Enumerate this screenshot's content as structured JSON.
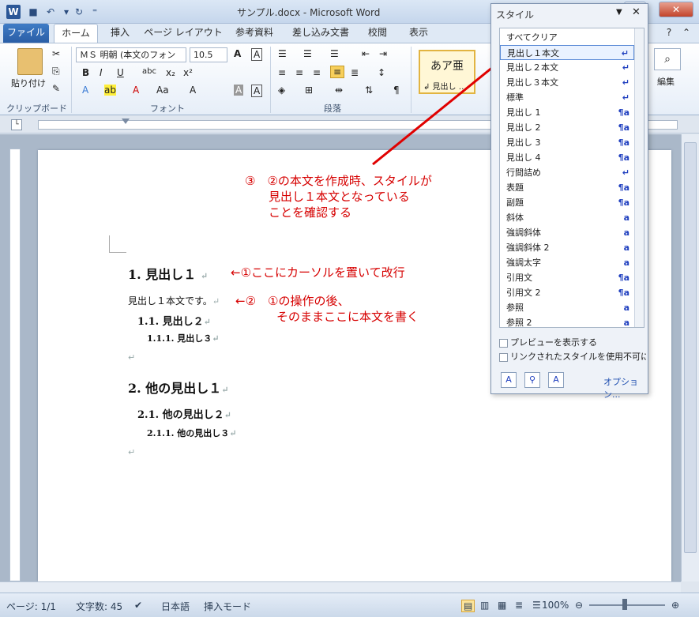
{
  "window": {
    "title": "サンプル.docx - Microsoft Word"
  },
  "tabs": [
    {
      "label": "ファイル"
    },
    {
      "label": "ホーム"
    },
    {
      "label": "挿入"
    },
    {
      "label": "ページ レイアウト"
    },
    {
      "label": "参考資料"
    },
    {
      "label": "差し込み文書"
    },
    {
      "label": "校閲"
    },
    {
      "label": "表示"
    }
  ],
  "ribbon": {
    "paste_label": "貼り付け",
    "font_name": "ＭＳ 明朝 (本文のフォン",
    "font_size": "10.5",
    "style_preview_text": "あア亜",
    "style_preview_name": "↲ 見出し …",
    "edit_label": "編集",
    "groups": {
      "clipboard": "クリップボード",
      "font": "フォント",
      "paragraph": "段落"
    }
  },
  "document": {
    "h1_first": "1. 見出し１",
    "body_first": "見出し１本文です。",
    "h2_first": "1.1. 見出し２",
    "h3_first": "1.1.1. 見出し３",
    "h1_second": "2. 他の見出し１",
    "h2_second": "2.1. 他の見出し２",
    "h3_second": "2.1.1. 他の見出し３",
    "para_mark": "↵"
  },
  "annotations": {
    "note1": "←①ここにカーソルを置いて改行",
    "note2_line1": "←②　①の操作の後、",
    "note2_line2": "そのままここに本文を書く",
    "note3_line1": "③　②の本文を作成時、スタイルが",
    "note3_line2": "見出し１本文となっている",
    "note3_line3": "ことを確認する"
  },
  "style_pane": {
    "title": "スタイル",
    "items": [
      {
        "name": "すべてクリア",
        "sym": ""
      },
      {
        "name": "見出し１本文",
        "sym": "↵"
      },
      {
        "name": "見出し２本文",
        "sym": "↵"
      },
      {
        "name": "見出し３本文",
        "sym": "↵"
      },
      {
        "name": "標準",
        "sym": "↵"
      },
      {
        "name": "見出し 1",
        "sym": "¶a"
      },
      {
        "name": "見出し 2",
        "sym": "¶a"
      },
      {
        "name": "見出し 3",
        "sym": "¶a"
      },
      {
        "name": "見出し 4",
        "sym": "¶a"
      },
      {
        "name": "行間詰め",
        "sym": "↵"
      },
      {
        "name": "表題",
        "sym": "¶a"
      },
      {
        "name": "副題",
        "sym": "¶a"
      },
      {
        "name": "斜体",
        "sym": "a"
      },
      {
        "name": "強調斜体",
        "sym": "a"
      },
      {
        "name": "強調斜体 2",
        "sym": "a"
      },
      {
        "name": "強調太字",
        "sym": "a"
      },
      {
        "name": "引用文",
        "sym": "¶a"
      },
      {
        "name": "引用文 2",
        "sym": "¶a"
      },
      {
        "name": "参照",
        "sym": "a"
      },
      {
        "name": "参照 2",
        "sym": "a"
      }
    ],
    "preview_checkbox": "プレビューを表示する",
    "linked_checkbox": "リンクされたスタイルを使用不可にする",
    "options_link": "オプション..."
  },
  "status": {
    "page": "ページ: 1/1",
    "chars": "文字数: 45",
    "language": "日本語",
    "mode": "挿入モード",
    "zoom": "100%"
  },
  "colors": {
    "annotation": "#d60000",
    "accent": "#2b5797"
  }
}
